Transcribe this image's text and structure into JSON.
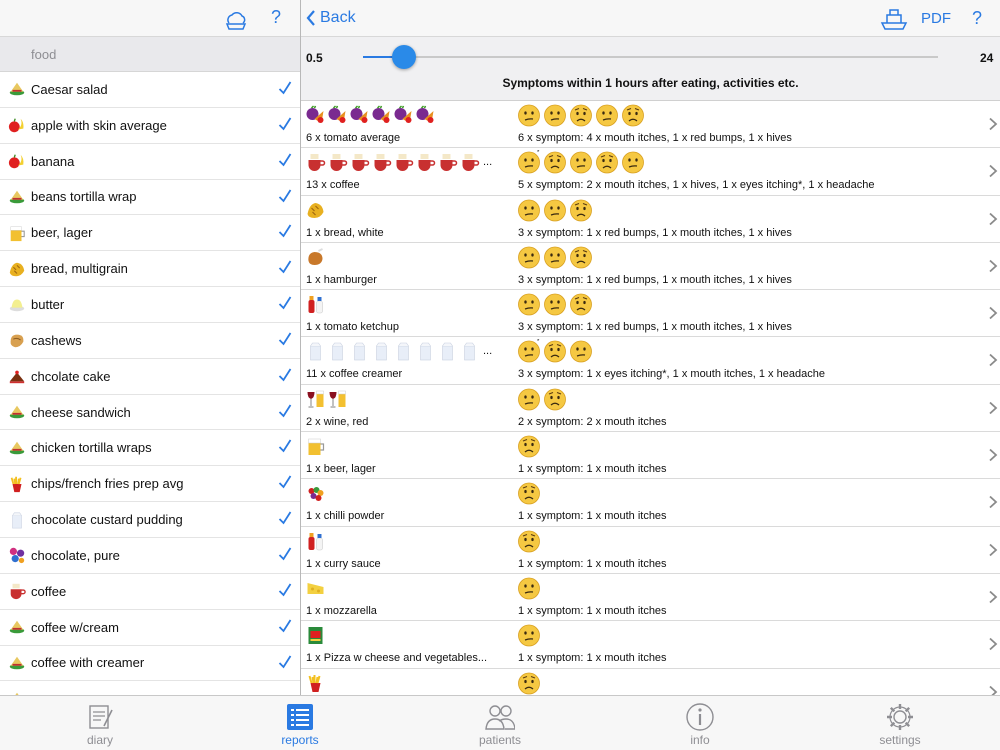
{
  "left_pane": {
    "search_placeholder": "food",
    "foods": [
      {
        "label": "Caesar salad",
        "icon": "salad-icon",
        "checked": true
      },
      {
        "label": "apple with skin average",
        "icon": "fruit-icon",
        "checked": true
      },
      {
        "label": "banana",
        "icon": "fruit-icon",
        "checked": true
      },
      {
        "label": "beans tortilla wrap",
        "icon": "salad-icon",
        "checked": true
      },
      {
        "label": "beer, lager",
        "icon": "beer-icon",
        "checked": true
      },
      {
        "label": "bread, multigrain",
        "icon": "bread-icon",
        "checked": true
      },
      {
        "label": "butter",
        "icon": "butter-icon",
        "checked": true
      },
      {
        "label": "cashews",
        "icon": "nut-icon",
        "checked": true
      },
      {
        "label": "chcolate cake",
        "icon": "cake-icon",
        "checked": true
      },
      {
        "label": "cheese sandwich",
        "icon": "salad-icon",
        "checked": true
      },
      {
        "label": "chicken tortilla wraps",
        "icon": "salad-icon",
        "checked": true
      },
      {
        "label": "chips/french fries prep avg",
        "icon": "fries-icon",
        "checked": true
      },
      {
        "label": "chocolate custard pudding",
        "icon": "milk-icon",
        "checked": true
      },
      {
        "label": "chocolate, pure",
        "icon": "candy-icon",
        "checked": true
      },
      {
        "label": "coffee",
        "icon": "coffee-icon",
        "checked": true
      },
      {
        "label": "coffee w/cream",
        "icon": "salad-icon",
        "checked": true
      },
      {
        "label": "coffee with creamer",
        "icon": "salad-icon",
        "checked": true
      },
      {
        "label": "",
        "icon": "salad-icon",
        "checked": false
      }
    ]
  },
  "header": {
    "back_label": "Back",
    "pdf_label": "PDF",
    "help_label": "?"
  },
  "controls": {
    "slider_min": "0.5",
    "slider_max": "24",
    "slider_value_fraction": 0.0426,
    "caption": "Symptoms within 1 hours after eating, activities etc."
  },
  "report_rows": [
    {
      "food_icon": "vegetables-icon",
      "food_count": 6,
      "more": false,
      "food_text": "6 x tomato average",
      "faces": [
        "neutral",
        "neutral",
        "worried",
        "neutral",
        "worried"
      ],
      "symptom_text": "6 x symptom: 4 x mouth itches, 1 x red bumps, 1 x hives"
    },
    {
      "food_icon": "coffee-icon",
      "food_count": 8,
      "more": true,
      "food_text": "13 x coffee",
      "faces": [
        "neutral-star",
        "worried",
        "neutral",
        "worried",
        "neutral"
      ],
      "symptom_text": "5 x symptom: 2 x mouth itches, 1 x hives, 1 x eyes itching*, 1 x headache"
    },
    {
      "food_icon": "bread-icon",
      "food_count": 1,
      "more": false,
      "food_text": "1 x bread, white",
      "faces": [
        "neutral",
        "neutral",
        "worried"
      ],
      "symptom_text": "3 x symptom: 1 x red bumps, 1 x mouth itches, 1 x hives"
    },
    {
      "food_icon": "chicken-icon",
      "food_count": 1,
      "more": false,
      "food_text": "1 x hamburger",
      "faces": [
        "neutral",
        "neutral",
        "worried"
      ],
      "symptom_text": "3 x symptom: 1 x red bumps, 1 x mouth itches, 1 x hives"
    },
    {
      "food_icon": "sauce-icon",
      "food_count": 1,
      "more": false,
      "food_text": "1 x tomato ketchup",
      "faces": [
        "neutral",
        "neutral",
        "worried"
      ],
      "symptom_text": "3 x symptom: 1 x red bumps, 1 x mouth itches, 1 x hives"
    },
    {
      "food_icon": "milk-icon",
      "food_count": 8,
      "more": true,
      "food_text": "11 x coffee creamer",
      "faces": [
        "neutral-star",
        "worried",
        "neutral"
      ],
      "symptom_text": "3 x symptom: 1 x eyes itching*, 1 x mouth itches, 1 x headache"
    },
    {
      "food_icon": "wine-icon",
      "food_count": 2,
      "more": false,
      "food_text": "2 x wine, red",
      "faces": [
        "neutral",
        "worried"
      ],
      "symptom_text": "2 x symptom: 2 x mouth itches"
    },
    {
      "food_icon": "beer-icon",
      "food_count": 1,
      "more": false,
      "food_text": "1 x beer, lager",
      "faces": [
        "worried"
      ],
      "symptom_text": "1 x symptom: 1 x mouth itches"
    },
    {
      "food_icon": "grapes-icon",
      "food_count": 1,
      "more": false,
      "food_text": "1 x chilli powder",
      "faces": [
        "worried"
      ],
      "symptom_text": "1 x symptom: 1 x mouth itches"
    },
    {
      "food_icon": "sauce-icon",
      "food_count": 1,
      "more": false,
      "food_text": "1 x curry sauce",
      "faces": [
        "worried"
      ],
      "symptom_text": "1 x symptom: 1 x mouth itches"
    },
    {
      "food_icon": "cheese-icon",
      "food_count": 1,
      "more": false,
      "food_text": "1 x mozzarella",
      "faces": [
        "neutral"
      ],
      "symptom_text": "1 x symptom: 1 x mouth itches"
    },
    {
      "food_icon": "box-icon",
      "food_count": 1,
      "more": false,
      "food_text": "1 x Pizza w cheese and vegetables...",
      "faces": [
        "neutral"
      ],
      "symptom_text": "1 x symptom: 1 x mouth itches"
    },
    {
      "food_icon": "fries-icon",
      "food_count": 1,
      "more": false,
      "food_text": "",
      "faces": [
        "worried"
      ],
      "symptom_text": ""
    }
  ],
  "tabbar": {
    "tabs": [
      {
        "label": "diary",
        "icon": "notepad-icon",
        "active": false
      },
      {
        "label": "reports",
        "icon": "list-icon",
        "active": true
      },
      {
        "label": "patients",
        "icon": "people-icon",
        "active": false
      },
      {
        "label": "info",
        "icon": "info-icon",
        "active": false
      },
      {
        "label": "settings",
        "icon": "gear-icon",
        "active": false
      }
    ]
  },
  "colors": {
    "accent": "#2a7ae2",
    "face_fill": "#f5c842",
    "tab_inactive": "#8e8e93"
  },
  "more_marker": "..."
}
